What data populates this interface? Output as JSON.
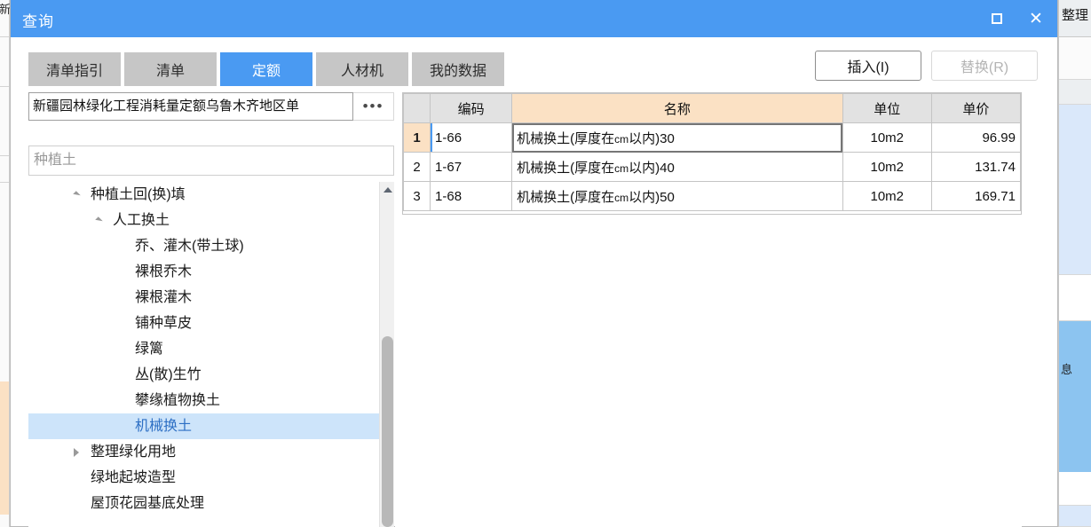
{
  "window": {
    "title": "查询",
    "maximize_label": "□",
    "close_label": "✕"
  },
  "toolbar": {
    "tabs": [
      {
        "label": "清单指引",
        "active": false
      },
      {
        "label": "清单",
        "active": false
      },
      {
        "label": "定额",
        "active": true
      },
      {
        "label": "人材机",
        "active": false
      },
      {
        "label": "我的数据",
        "active": false
      }
    ],
    "insert_label": "插入(I)",
    "replace_label": "替换(R)"
  },
  "left_panel": {
    "catalog_value": "新疆园林绿化工程消耗量定额乌鲁木齐地区单",
    "catalog_more_label": "•••",
    "search_value": "种植土",
    "tree": [
      {
        "label": "种植土回(换)填",
        "indent": 0,
        "arrow": "down",
        "selected": false
      },
      {
        "label": "人工换土",
        "indent": 1,
        "arrow": "down",
        "selected": false
      },
      {
        "label": "乔、灌木(带土球)",
        "indent": 2,
        "arrow": "none",
        "selected": false
      },
      {
        "label": "裸根乔木",
        "indent": 2,
        "arrow": "none",
        "selected": false
      },
      {
        "label": "裸根灌木",
        "indent": 2,
        "arrow": "none",
        "selected": false
      },
      {
        "label": "铺种草皮",
        "indent": 2,
        "arrow": "none",
        "selected": false
      },
      {
        "label": "绿篱",
        "indent": 2,
        "arrow": "none",
        "selected": false
      },
      {
        "label": "丛(散)生竹",
        "indent": 2,
        "arrow": "none",
        "selected": false
      },
      {
        "label": "攀缘植物换土",
        "indent": 2,
        "arrow": "none",
        "selected": false
      },
      {
        "label": "机械换土",
        "indent": 2,
        "arrow": "none",
        "selected": true
      },
      {
        "label": "整理绿化用地",
        "indent": 0,
        "arrow": "right",
        "selected": false
      },
      {
        "label": "绿地起坡造型",
        "indent": 0,
        "arrow": "none",
        "selected": false
      },
      {
        "label": "屋顶花园基底处理",
        "indent": 0,
        "arrow": "none",
        "selected": false
      }
    ]
  },
  "table": {
    "headers": {
      "index": "",
      "code": "编码",
      "name": "名称",
      "unit": "单位",
      "price": "单价"
    },
    "active_column": "名称",
    "rows": [
      {
        "index": "1",
        "code": "1-66",
        "name_prefix": "机械换土(厚度在",
        "name_unit": "cm",
        "name_suffix": "以内)30",
        "unit": "10m2",
        "price": "96.99",
        "selected": true
      },
      {
        "index": "2",
        "code": "1-67",
        "name_prefix": "机械换土(厚度在",
        "name_unit": "cm",
        "name_suffix": "以内)40",
        "unit": "10m2",
        "price": "131.74",
        "selected": false
      },
      {
        "index": "3",
        "code": "1-68",
        "name_prefix": "机械换土(厚度在",
        "name_unit": "cm",
        "name_suffix": "以内)50",
        "unit": "10m2",
        "price": "169.71",
        "selected": false
      }
    ]
  },
  "background": {
    "left_text": "新",
    "right_header": "整理",
    "right_selected_text": "息"
  },
  "colors": {
    "accent": "#4a9af2",
    "tab_inactive": "#c6c6c6",
    "header": "#e2e2e2",
    "active_column": "#fbe1c4",
    "selection": "#cde4fa"
  }
}
